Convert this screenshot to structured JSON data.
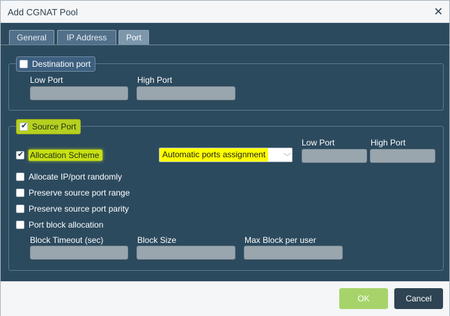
{
  "dialog": {
    "title": "Add CGNAT Pool"
  },
  "tabs": [
    {
      "label": "General",
      "active": false
    },
    {
      "label": "IP Address",
      "active": false
    },
    {
      "label": "Port",
      "active": true
    }
  ],
  "destination_port": {
    "label": "Destination port",
    "checked": false,
    "low_port_label": "Low Port",
    "low_port_value": "",
    "high_port_label": "High Port",
    "high_port_value": ""
  },
  "source_port": {
    "label": "Source Port",
    "checked": true,
    "allocation_scheme": {
      "label": "Allocation Scheme",
      "checked": true,
      "selected": "Automatic ports assignment"
    },
    "low_port_label": "Low Port",
    "low_port_value": "",
    "high_port_label": "High Port",
    "high_port_value": "",
    "options": [
      {
        "label": "Allocate IP/port randomly",
        "checked": false
      },
      {
        "label": "Preserve source port range",
        "checked": false
      },
      {
        "label": "Preserve source port parity",
        "checked": false
      },
      {
        "label": "Port block allocation",
        "checked": false
      }
    ],
    "block_timeout_label": "Block Timeout (sec)",
    "block_timeout_value": "",
    "block_size_label": "Block Size",
    "block_size_value": "",
    "max_block_label": "Max Block per user",
    "max_block_value": ""
  },
  "footer": {
    "ok_label": "OK",
    "cancel_label": "Cancel"
  },
  "colors": {
    "panel": "#2c4a5e",
    "highlight": "#c8e014",
    "ok": "#a6d46a",
    "cancel": "#2e4454",
    "select_highlight": "#ffff00"
  },
  "icons": {
    "close": "close-icon",
    "check": "checkmark-icon",
    "dropdown": "chevron-down-icon"
  }
}
